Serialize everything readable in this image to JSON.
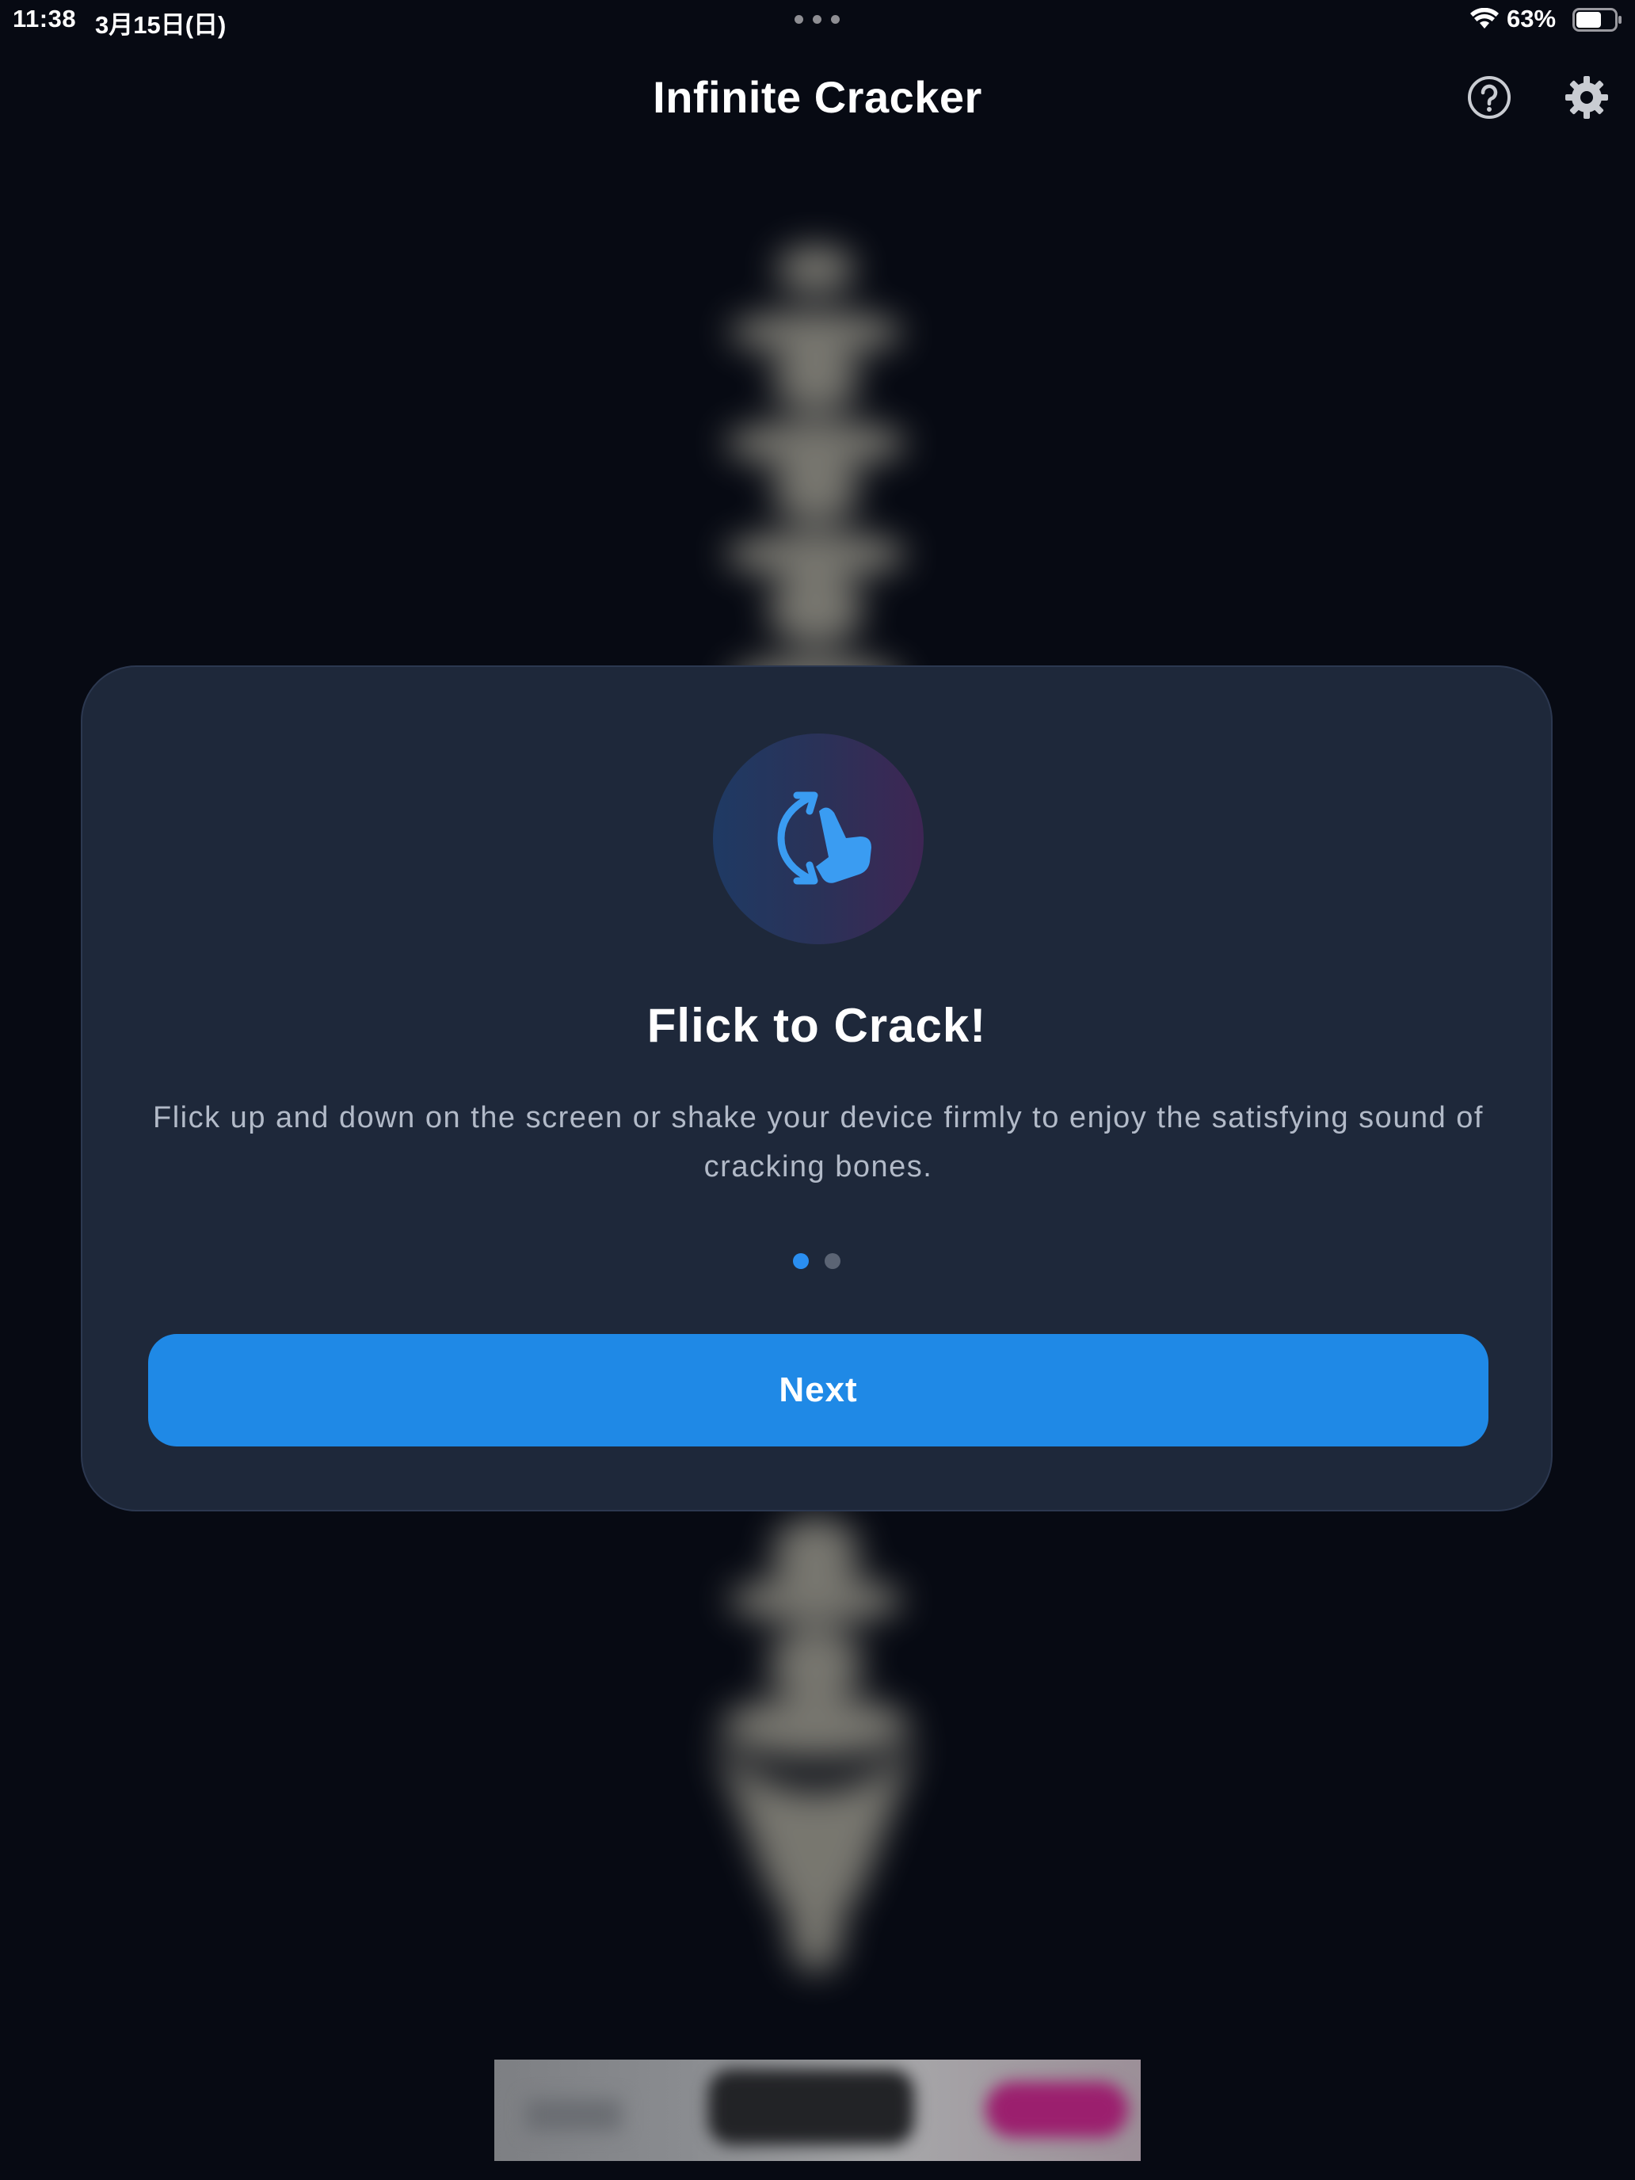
{
  "status_bar": {
    "time": "11:38",
    "date": "3月15日(日)",
    "battery_percent": "63%",
    "battery_level": 0.63,
    "icons": [
      "multitasking-dots-icon",
      "wifi-icon",
      "battery-icon"
    ]
  },
  "nav": {
    "title": "Infinite Cracker",
    "help_icon": "question-circle-icon",
    "settings_icon": "gear-icon"
  },
  "onboarding": {
    "icon": "flick-hand-rotate-icon",
    "title": "Flick to Crack!",
    "description": "Flick up and down on the screen or shake your device firmly to enjoy the satisfying sound of cracking bones.",
    "page_count": 2,
    "current_page": 1,
    "next_label": "Next"
  },
  "colors": {
    "background": "#070a13",
    "card": "#1e283a",
    "accent": "#1f89e6",
    "text_secondary": "#b2bac8"
  }
}
